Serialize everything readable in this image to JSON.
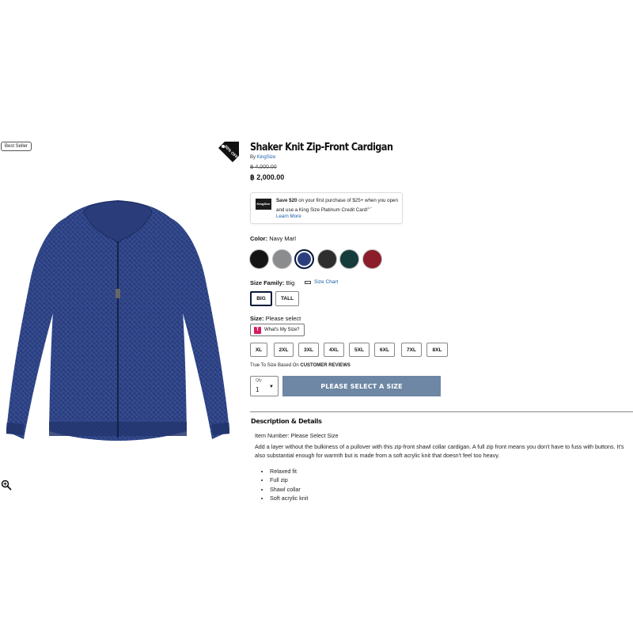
{
  "badge": "Best Seller",
  "sale_tag": "50% OFF",
  "product": {
    "title": "Shaker Knit Zip-Front Cardigan",
    "by_prefix": "By",
    "brand": "KingSize",
    "price_old": "฿ 4,000.00",
    "price_new": "฿ 2,000.00"
  },
  "promo": {
    "logo_text": "KingSize",
    "bold": "Save $20",
    "text": " on your first purchase of $25+ when you open and use a King Size Platinum Credit Card!",
    "sup": "1,*",
    "link": "Learn More"
  },
  "color": {
    "label": "Color:",
    "value": "Navy Marl",
    "swatches": [
      {
        "name": "black",
        "hex": "#151515"
      },
      {
        "name": "grey",
        "hex": "#8a8c8e"
      },
      {
        "name": "navy-marl",
        "hex": "#2b3f7e"
      },
      {
        "name": "charcoal",
        "hex": "#2e2e2e"
      },
      {
        "name": "teal",
        "hex": "#163c3b"
      },
      {
        "name": "burgundy",
        "hex": "#8c1d2a"
      }
    ]
  },
  "size_family": {
    "label": "Size Family:",
    "value": "Big",
    "size_chart": "Size Chart",
    "options": [
      "BIG",
      "TALL"
    ]
  },
  "size": {
    "label": "Size:",
    "value": "Please select",
    "whats_my_size": "What's My Size?",
    "options": [
      "XL",
      "2XL",
      "3XL",
      "4XL",
      "5XL",
      "6XL",
      "7XL",
      "8XL"
    ]
  },
  "true_to_size": {
    "text": "True To Size Based On",
    "link": "CUSTOMER REVIEWS"
  },
  "qty": {
    "label": "Qty",
    "value": "1"
  },
  "cta": "PLEASE SELECT A SIZE",
  "description": {
    "heading": "Description & Details",
    "item_number": "Item Number: Please Select Size",
    "body": "Add a layer without the bulkiness of a pullover with this zip-front shawl collar cardigan. A full zip front means you don't have to fuss with buttons. It's also substantial enough for warmth but is made from a soft acrylic knit that doesn't feel too heavy.",
    "bullets": [
      "Relaxed fit",
      "Full zip",
      "Shawl collar",
      "Soft acrylic knit"
    ]
  },
  "colors": {
    "cta_bg": "#6d87a4",
    "link": "#1a5ea8",
    "product": "#2b3f7e"
  }
}
